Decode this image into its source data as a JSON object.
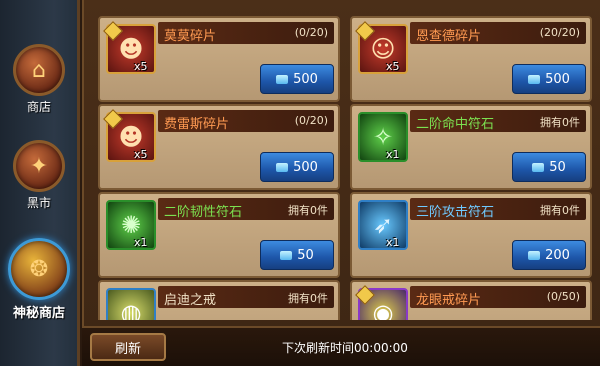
{
  "sidebar": {
    "items": [
      {
        "label": "商店",
        "icon": "shop-icon"
      },
      {
        "label": "黑市",
        "icon": "black-market-icon"
      },
      {
        "label": "神秘商店",
        "icon": "mystery-shop-icon"
      }
    ]
  },
  "items": [
    {
      "name": "莫莫碎片",
      "count": "(0/20)",
      "qty": "x5",
      "price": "500",
      "icon": "hero-fragment-icon"
    },
    {
      "name": "恩查德碎片",
      "count": "(20/20)",
      "qty": "x5",
      "price": "500",
      "icon": "hero-fragment-icon"
    },
    {
      "name": "费雷斯碎片",
      "count": "(0/20)",
      "qty": "x5",
      "price": "500",
      "icon": "hero-fragment-icon"
    },
    {
      "name": "二阶命中符石",
      "count": "拥有0件",
      "qty": "x1",
      "price": "50",
      "icon": "rune-icon"
    },
    {
      "name": "二阶韧性符石",
      "count": "拥有0件",
      "qty": "x1",
      "price": "50",
      "icon": "rune-icon"
    },
    {
      "name": "三阶攻击符石",
      "count": "拥有0件",
      "qty": "x1",
      "price": "200",
      "icon": "rune-icon"
    },
    {
      "name": "启迪之戒",
      "count": "拥有0件",
      "qty": "",
      "price": "",
      "icon": "ring-icon"
    },
    {
      "name": "龙眼戒碎片",
      "count": "(0/50)",
      "qty": "",
      "price": "",
      "icon": "ring-fragment-icon"
    }
  ],
  "footer": {
    "refresh_label": "刷新",
    "timer_text": "下次刷新时间00:00:00"
  },
  "colors": {
    "fragment_name": "#ff9a52",
    "rune_green_name": "#7ce050",
    "rune_blue_name": "#6fc9ff",
    "price_button": "#1d55a8"
  }
}
